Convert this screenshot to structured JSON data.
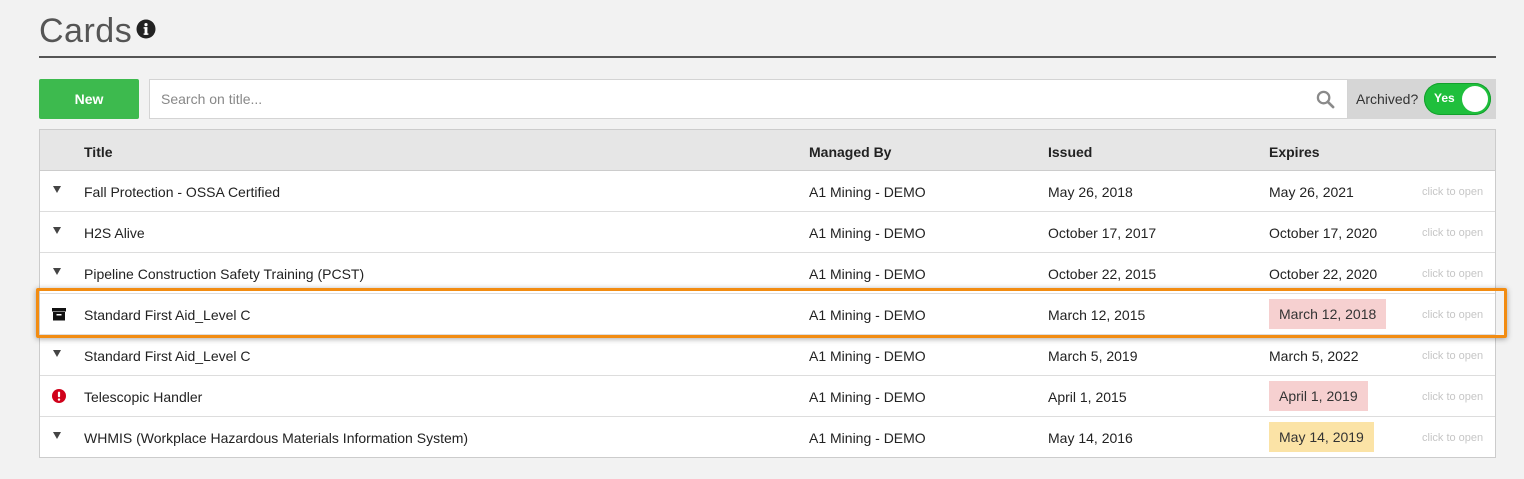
{
  "page": {
    "title": "Cards"
  },
  "toolbar": {
    "new_label": "New",
    "search_placeholder": "Search on title...",
    "archived_label": "Archived?",
    "archived_toggle": "Yes"
  },
  "table": {
    "headers": {
      "title": "Title",
      "managed_by": "Managed By",
      "issued": "Issued",
      "expires": "Expires"
    },
    "rows": [
      {
        "icon": "caret-down-icon",
        "title": "Fall Protection - OSSA Certified",
        "managed_by": "A1 Mining - DEMO",
        "issued": "May 26, 2018",
        "expires": "May 26, 2021",
        "expires_status": "none",
        "open": "click to open"
      },
      {
        "icon": "caret-down-icon",
        "title": "H2S Alive",
        "managed_by": "A1 Mining - DEMO",
        "issued": "October 17, 2017",
        "expires": "October 17, 2020",
        "expires_status": "none",
        "open": "click to open"
      },
      {
        "icon": "caret-down-icon",
        "title": "Pipeline Construction Safety Training (PCST)",
        "managed_by": "A1 Mining - DEMO",
        "issued": "October 22, 2015",
        "expires": "October 22, 2020",
        "expires_status": "none",
        "open": "click to open"
      },
      {
        "icon": "archive-box-icon",
        "title": "Standard First Aid_Level C",
        "managed_by": "A1 Mining - DEMO",
        "issued": "March 12, 2015",
        "expires": "March 12, 2018",
        "expires_status": "expired",
        "open": "click to open"
      },
      {
        "icon": "caret-down-icon",
        "title": "Standard First Aid_Level C",
        "managed_by": "A1 Mining - DEMO",
        "issued": "March 5, 2019",
        "expires": "March 5, 2022",
        "expires_status": "none",
        "open": "click to open"
      },
      {
        "icon": "alert-exclamation-icon",
        "title": "Telescopic Handler",
        "managed_by": "A1 Mining - DEMO",
        "issued": "April 1, 2015",
        "expires": "April 1, 2019",
        "expires_status": "expired",
        "open": "click to open"
      },
      {
        "icon": "caret-down-icon",
        "title": "WHMIS (Workplace Hazardous Materials Information System)",
        "managed_by": "A1 Mining - DEMO",
        "issued": "May 14, 2016",
        "expires": "May 14, 2019",
        "expires_status": "expiring-soon",
        "open": "click to open"
      }
    ]
  },
  "colors": {
    "new_button": "#3dba4e",
    "toggle_on": "#1fbf3c",
    "expired_badge": "#f6d0d0",
    "expiring_badge": "#fbe3a6",
    "highlight": "#f28c12",
    "alert_icon": "#d0021b"
  }
}
